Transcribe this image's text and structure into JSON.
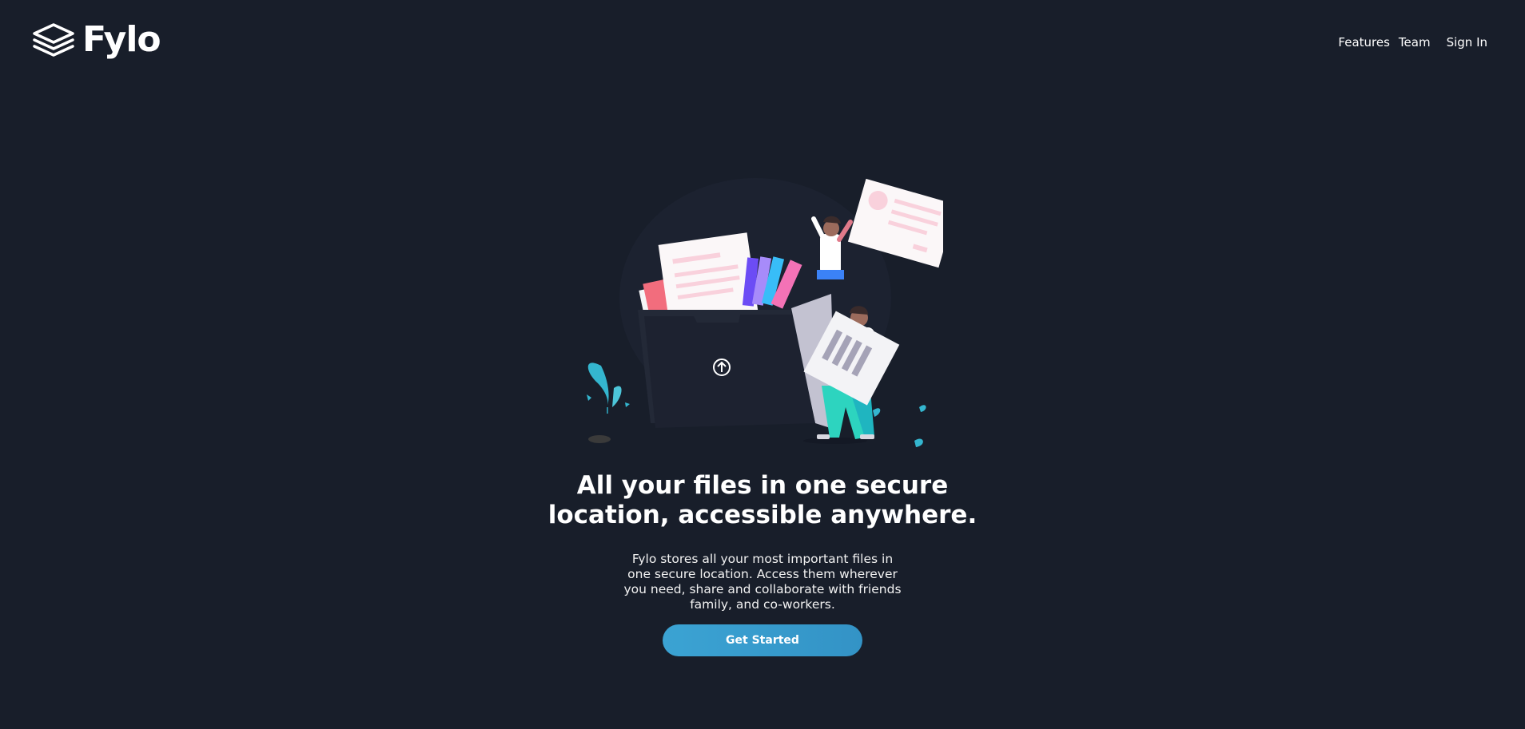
{
  "brand": {
    "name": "Fylo",
    "icon": "stacked-layers-icon"
  },
  "nav": {
    "items": [
      {
        "label": "Features"
      },
      {
        "label": "Team"
      },
      {
        "label": "Sign In"
      }
    ]
  },
  "hero": {
    "illustration": "file-upload-illustration",
    "headline_line1": "All your files in one secure",
    "headline_line2": "location, accessible anywhere.",
    "description": "Fylo stores all your most important files in one secure location. Access them wherever you need, share and collaborate with friends family, and co-workers.",
    "cta_label": "Get Started"
  },
  "colors": {
    "background": "#181e2a",
    "cta": "#3ba3d3",
    "text": "#ffffff"
  }
}
